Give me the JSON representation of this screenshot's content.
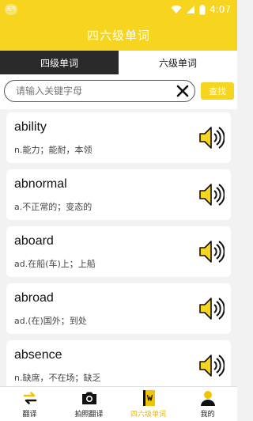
{
  "statusbar": {
    "badge": "天气",
    "time": "4:07"
  },
  "header": {
    "title": "四六级单词"
  },
  "tabs": [
    {
      "label": "四级单词",
      "active": true
    },
    {
      "label": "六级单词",
      "active": false
    }
  ],
  "search": {
    "placeholder": "请输入关键字母",
    "value": "",
    "button_label": "查找",
    "clear_icon": "close-icon"
  },
  "words": [
    {
      "word": "ability",
      "meaning": "n.能力；能耐，本领"
    },
    {
      "word": "abnormal",
      "meaning": "a.不正常的；变态的"
    },
    {
      "word": "aboard",
      "meaning": "ad.在船(车)上；上船"
    },
    {
      "word": "abroad",
      "meaning": "ad.(在)国外；到处"
    },
    {
      "word": "absence",
      "meaning": "n.缺席，不在场；缺乏"
    }
  ],
  "bottom_nav": [
    {
      "label": "翻译",
      "icon": "translate-icon",
      "active": false
    },
    {
      "label": "拍照翻译",
      "icon": "camera-icon",
      "active": false
    },
    {
      "label": "四六级单词",
      "icon": "vocabulary-book-icon",
      "active": true
    },
    {
      "label": "我的",
      "icon": "profile-icon",
      "active": false
    }
  ],
  "colors": {
    "accent": "#f7d41d",
    "tab_active_bg": "#2a2a2a",
    "active_nav_label": "#e6b800"
  }
}
